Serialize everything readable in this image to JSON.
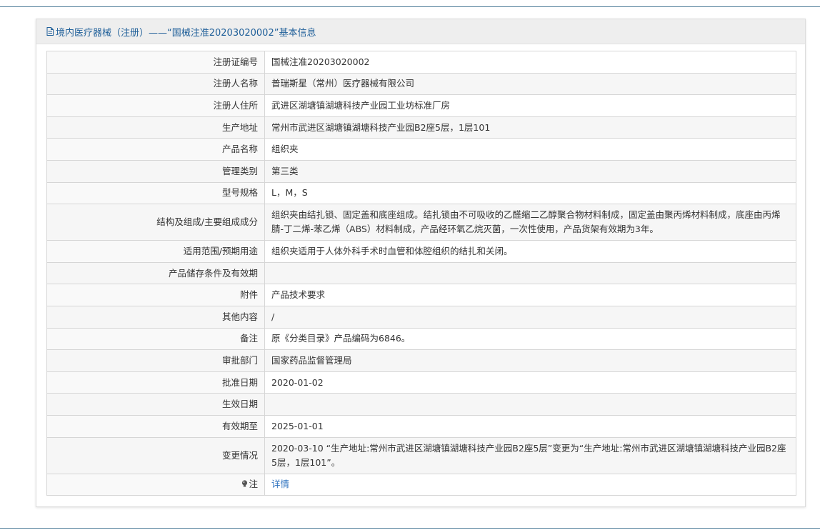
{
  "header": {
    "title": "境内医疗器械（注册）——“国械注准20203020002”基本信息"
  },
  "rows": [
    {
      "label": "注册证编号",
      "value": "国械注准20203020002"
    },
    {
      "label": "注册人名称",
      "value": "普瑞斯星（常州）医疗器械有限公司"
    },
    {
      "label": "注册人住所",
      "value": "武进区湖塘镇湖塘科技产业园工业坊标准厂房"
    },
    {
      "label": "生产地址",
      "value": "常州市武进区湖塘镇湖塘科技产业园B2座5层，1层101"
    },
    {
      "label": "产品名称",
      "value": "组织夹"
    },
    {
      "label": "管理类别",
      "value": "第三类"
    },
    {
      "label": "型号规格",
      "value": "L，M，S"
    },
    {
      "label": "结构及组成/主要组成成分",
      "value": "组织夹由结扎锁、固定盖和底座组成。结扎锁由不可吸收的乙醛缩二乙醇聚合物材料制成，固定盖由聚丙烯材料制成，底座由丙烯腈-丁二烯-苯乙烯（ABS）材料制成，产品经环氧乙烷灭菌，一次性使用，产品货架有效期为3年。"
    },
    {
      "label": "适用范围/预期用途",
      "value": "组织夹适用于人体外科手术时血管和体腔组织的结扎和关闭。"
    },
    {
      "label": "产品储存条件及有效期",
      "value": ""
    },
    {
      "label": "附件",
      "value": "产品技术要求"
    },
    {
      "label": "其他内容",
      "value": "/"
    },
    {
      "label": "备注",
      "value": "原《分类目录》产品编码为6846。"
    },
    {
      "label": "审批部门",
      "value": "国家药品监督管理局"
    },
    {
      "label": "批准日期",
      "value": "2020-01-02"
    },
    {
      "label": "生效日期",
      "value": ""
    },
    {
      "label": "有效期至",
      "value": "2025-01-01"
    },
    {
      "label": "变更情况",
      "value": "2020-03-10 “生产地址:常州市武进区湖塘镇湖塘科技产业园B2座5层”变更为“生产地址:常州市武进区湖塘镇湖塘科技产业园B2座5层，1层101”。"
    }
  ],
  "note": {
    "label": "注",
    "link_text": "详情",
    "link_color": "#2a6fbe"
  },
  "colors": {
    "header_text": "#1f5f99",
    "rule": "#4a7a96"
  },
  "icons": {
    "header": "document-icon",
    "note": "lightbulb-icon"
  }
}
